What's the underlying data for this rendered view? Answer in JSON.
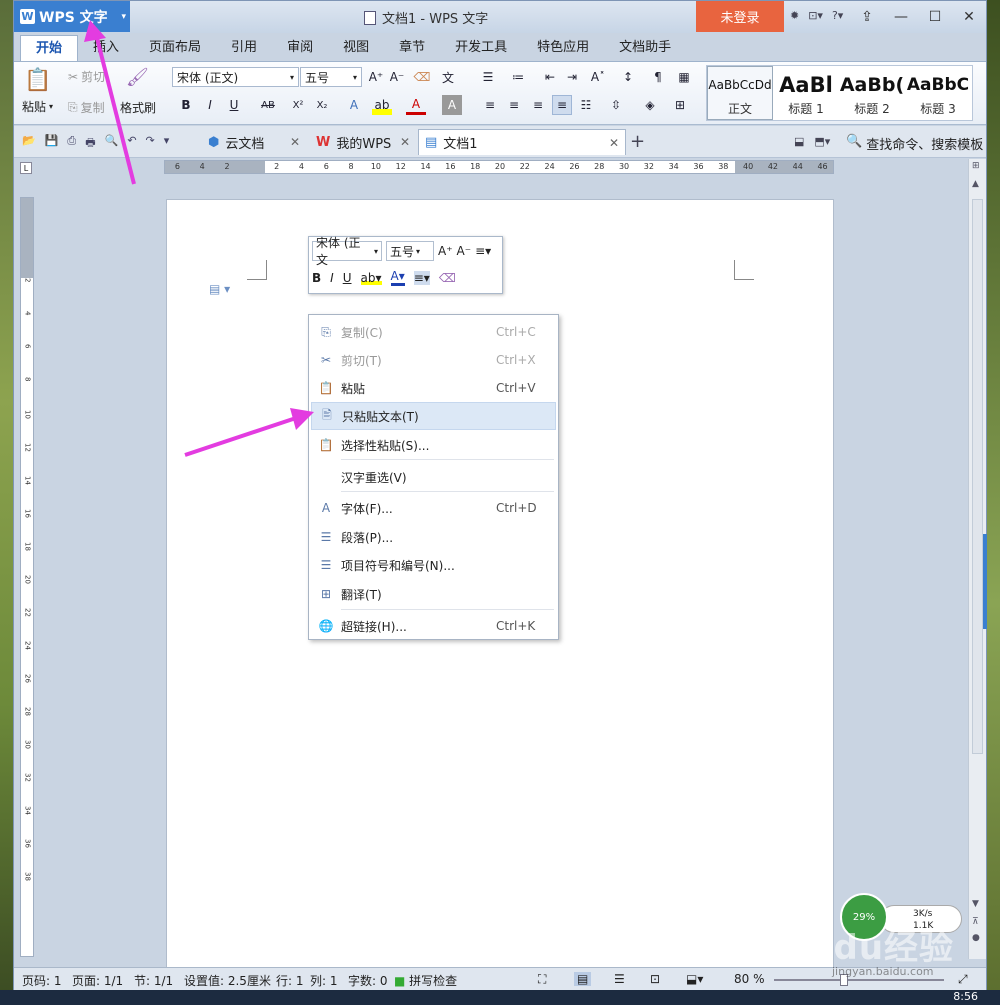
{
  "app": {
    "name": "WPS 文字",
    "title": "文档1 - WPS 文字",
    "login_label": "未登录"
  },
  "menu_tabs": [
    {
      "label": "开始",
      "active": true
    },
    {
      "label": "插入"
    },
    {
      "label": "页面布局"
    },
    {
      "label": "引用"
    },
    {
      "label": "审阅"
    },
    {
      "label": "视图"
    },
    {
      "label": "章节"
    },
    {
      "label": "开发工具"
    },
    {
      "label": "特色应用"
    },
    {
      "label": "文档助手"
    }
  ],
  "ribbon": {
    "paste_label": "粘贴",
    "cut_label": "剪切",
    "copy_label": "复制",
    "format_painter_label": "格式刷",
    "font_name": "宋体 (正文)",
    "font_size": "五号",
    "styles": [
      {
        "sample": "AaBbCcDd",
        "name": "正文"
      },
      {
        "sample": "AaBl",
        "name": "标题 1"
      },
      {
        "sample": "AaBb(",
        "name": "标题 2"
      },
      {
        "sample": "AaBbC",
        "name": "标题 3"
      }
    ]
  },
  "doc_tabs": [
    {
      "label": "云文档"
    },
    {
      "label": "我的WPS"
    },
    {
      "label": "文档1",
      "active": true
    }
  ],
  "search_label": "查找命令、搜索模板",
  "ruler": {
    "h_ticks": [
      "6",
      "4",
      "2",
      "",
      "2",
      "4",
      "6",
      "8",
      "10",
      "12",
      "14",
      "16",
      "18",
      "20",
      "22",
      "24",
      "26",
      "28",
      "30",
      "32",
      "34",
      "36",
      "38",
      "40",
      "42",
      "44",
      "46"
    ],
    "v_ticks": [
      "2",
      "4",
      "6",
      "8",
      "10",
      "12",
      "14",
      "16",
      "18",
      "20",
      "22",
      "24",
      "26",
      "28",
      "30",
      "32",
      "34",
      "36",
      "38"
    ]
  },
  "mini_toolbar": {
    "font_name": "宋体 (正文",
    "font_size": "五号"
  },
  "context_menu": [
    {
      "label": "复制(C)",
      "shortcut": "Ctrl+C",
      "icon": "copy-icon",
      "disabled": true
    },
    {
      "label": "剪切(T)",
      "shortcut": "Ctrl+X",
      "icon": "cut-icon",
      "disabled": true
    },
    {
      "label": "粘贴",
      "shortcut": "Ctrl+V",
      "icon": "paste-icon"
    },
    {
      "label": "只粘贴文本(T)",
      "shortcut": "",
      "icon": "paste-text-icon",
      "highlighted": true
    },
    {
      "label": "选择性粘贴(S)...",
      "shortcut": "",
      "icon": "paste-special-icon"
    },
    {
      "label": "汉字重选(V)",
      "shortcut": "",
      "icon": ""
    },
    {
      "label": "字体(F)...",
      "shortcut": "Ctrl+D",
      "icon": "font-icon"
    },
    {
      "label": "段落(P)...",
      "shortcut": "",
      "icon": "paragraph-icon"
    },
    {
      "label": "项目符号和编号(N)...",
      "shortcut": "",
      "icon": "bullets-icon"
    },
    {
      "label": "翻译(T)",
      "shortcut": "",
      "icon": "translate-icon"
    },
    {
      "label": "超链接(H)...",
      "shortcut": "Ctrl+K",
      "icon": "hyperlink-icon"
    }
  ],
  "status": {
    "page_num": "页码: 1",
    "pages": "页面: 1/1",
    "section": "节: 1/1",
    "setting": "设置值: 2.5厘米",
    "row": "行: 1",
    "col": "列: 1",
    "words": "字数: 0",
    "spell": "拼写检查",
    "zoom": "80 %"
  },
  "network_widget": {
    "percent": "29%",
    "speed_up": "3K/s",
    "speed_down": "1.1K"
  },
  "watermark": {
    "brand": "Baidu经验",
    "url": "jingyan.baidu.com"
  },
  "clock": "8:56",
  "colors": {
    "accent": "#3a7fd0",
    "login": "#e8643f",
    "arrow": "#e33ce0",
    "highlight": "#dce8f6"
  }
}
